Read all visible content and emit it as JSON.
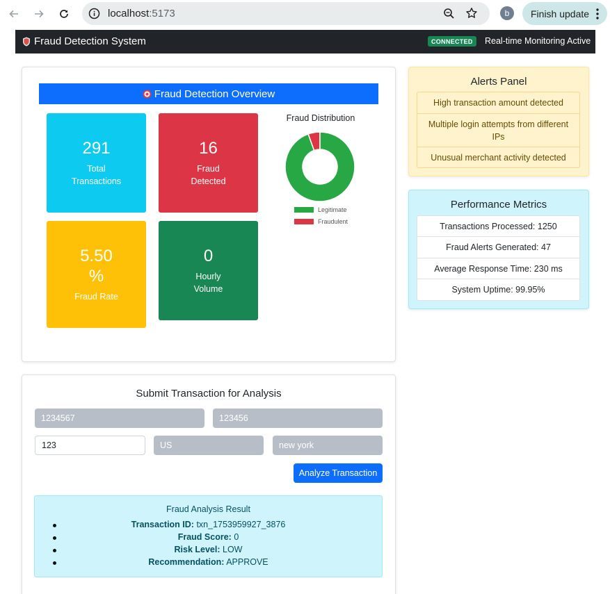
{
  "browser": {
    "url_host": "localhost",
    "url_port": ":5173",
    "profile_initial": "b",
    "update_label": "Finish update"
  },
  "app": {
    "title": "Fraud Detection System",
    "status_badge": "CONNECTED",
    "status_text": "Real-time Monitoring Active"
  },
  "overview": {
    "header": "Fraud Detection Overview",
    "stats": [
      {
        "value": "291",
        "label_line1": "Total",
        "label_line2": "Transactions",
        "color": "#0dcaf0"
      },
      {
        "value": "16",
        "label_line1": "Fraud",
        "label_line2": "Detected",
        "color": "#dc3545"
      },
      {
        "value_line1": "5.50",
        "value_line2": "%",
        "label": "Fraud Rate",
        "color": "#ffc107"
      },
      {
        "value": "0",
        "label_line1": "Hourly",
        "label_line2": "Volume",
        "color": "#198754"
      }
    ]
  },
  "chart_data": {
    "type": "pie",
    "title": "Fraud Distribution",
    "categories": [
      "Legitimate",
      "Fraudulent"
    ],
    "values": [
      275,
      16
    ],
    "colors": [
      "#28a745",
      "#dc3545"
    ],
    "legend_position": "bottom"
  },
  "alerts": {
    "title": "Alerts Panel",
    "items": [
      "High transaction amount detected",
      "Multiple login attempts from different IPs",
      "Unusual merchant activity detected"
    ]
  },
  "metrics": {
    "title": "Performance Metrics",
    "items": [
      "Transactions Processed: 1250",
      "Fraud Alerts Generated: 47",
      "Average Response Time: 230 ms",
      "System Uptime: 99.95%"
    ]
  },
  "form": {
    "title": "Submit Transaction for Analysis",
    "field1": "1234567",
    "field2": "123456",
    "field3": "123",
    "field4": "US",
    "field5": "new york",
    "submit_label": "Analyze Transaction"
  },
  "result": {
    "title": "Fraud Analysis Result",
    "rows": [
      {
        "label": "Transaction ID:",
        "value": "txn_1753959927_3876"
      },
      {
        "label": "Fraud Score:",
        "value": "0"
      },
      {
        "label": "Risk Level:",
        "value": "LOW"
      },
      {
        "label": "Recommendation:",
        "value": "APPROVE"
      }
    ]
  }
}
